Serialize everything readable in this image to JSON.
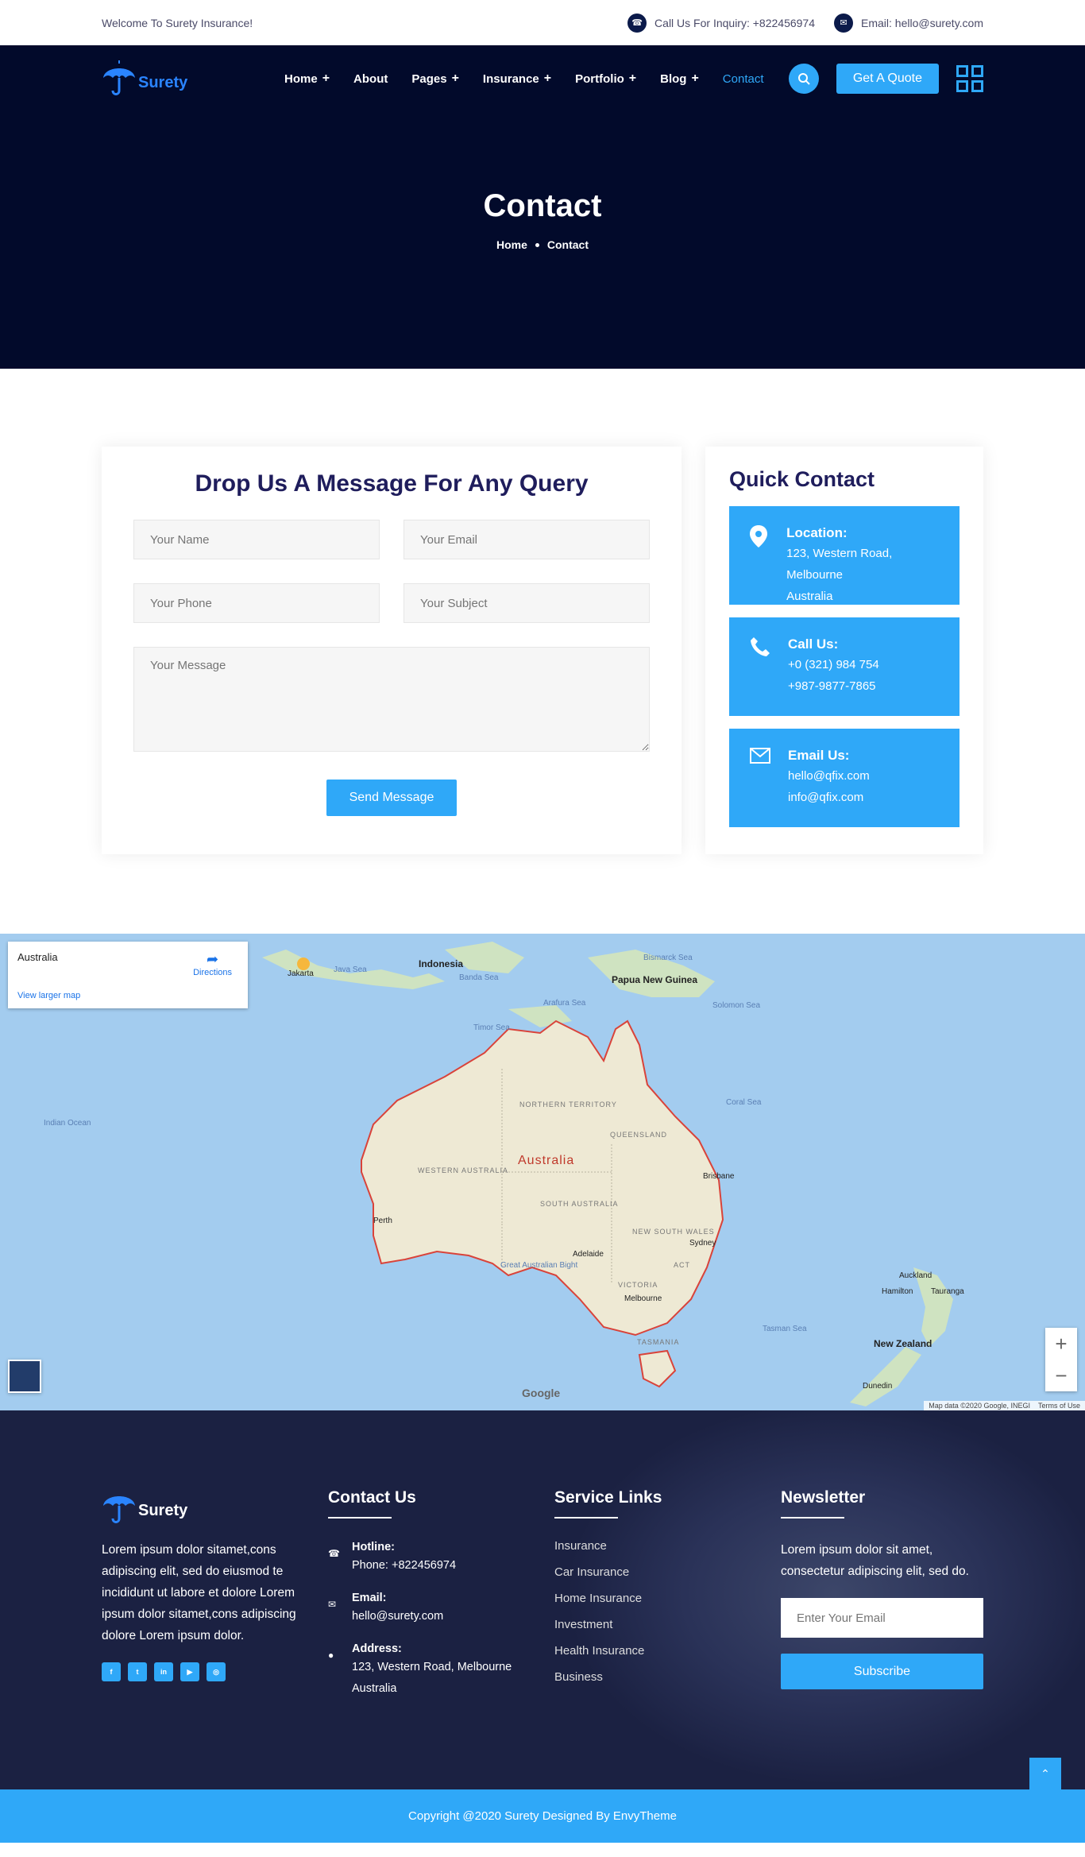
{
  "topbar": {
    "welcome": "Welcome To Surety Insurance!",
    "phone_text": "Call Us For Inquiry: +822456974",
    "email_text": "Email: hello@surety.com"
  },
  "brand": {
    "name": "Surety",
    "logo_icon": "umbrella-icon"
  },
  "nav": {
    "items": [
      {
        "label": "Home",
        "has_sub": true
      },
      {
        "label": "About",
        "has_sub": false
      },
      {
        "label": "Pages",
        "has_sub": true
      },
      {
        "label": "Insurance",
        "has_sub": true
      },
      {
        "label": "Portfolio",
        "has_sub": true
      },
      {
        "label": "Blog",
        "has_sub": true
      },
      {
        "label": "Contact",
        "has_sub": false,
        "active": true
      }
    ],
    "quote_label": "Get A Quote"
  },
  "hero": {
    "title": "Contact",
    "breadcrumb": [
      "Home",
      "Contact"
    ]
  },
  "form": {
    "title": "Drop Us A Message For Any Query",
    "name_placeholder": "Your Name",
    "email_placeholder": "Your Email",
    "phone_placeholder": "Your Phone",
    "subject_placeholder": "Your Subject",
    "message_placeholder": "Your Message",
    "send_label": "Send Message"
  },
  "quick_contact": {
    "title": "Quick Contact",
    "boxes": [
      {
        "icon": "location-pin-icon",
        "title": "Location:",
        "lines": [
          "123, Western Road, Melbourne",
          "Australia"
        ]
      },
      {
        "icon": "phone-icon",
        "title": "Call Us:",
        "lines": [
          "+0 (321) 984 754",
          "+987-9877-7865"
        ]
      },
      {
        "icon": "envelope-icon",
        "title": "Email Us:",
        "lines": [
          "hello@qfix.com",
          "info@qfix.com"
        ]
      }
    ]
  },
  "map": {
    "place": "Australia",
    "directions": "Directions",
    "view_larger": "View larger map",
    "country_label": "Australia",
    "labels": {
      "indonesia": "Indonesia",
      "java_sea": "Java Sea",
      "banda_sea": "Banda Sea",
      "png": "Papua New Guinea",
      "bismarck": "Bismarck Sea",
      "solomon": "Solomon Sea",
      "arafura": "Arafura Sea",
      "timor": "Timor Sea",
      "coral": "Coral Sea",
      "indian": "Indian Ocean",
      "tasman": "Tasman Sea",
      "nt": "NORTHERN TERRITORY",
      "qld": "QUEENSLAND",
      "wa": "WESTERN AUSTRALIA",
      "sa": "SOUTH AUSTRALIA",
      "nsw": "NEW SOUTH WALES",
      "vic": "VICTORIA",
      "act": "ACT",
      "tas": "TASMANIA",
      "gab": "Great Australian Bight",
      "jakarta": "Jakarta",
      "perth": "Perth",
      "adelaide": "Adelaide",
      "melbourne": "Melbourne",
      "sydney": "Sydney",
      "brisbane": "Brisbane",
      "auckland": "Auckland",
      "hamilton": "Hamilton",
      "tauranga": "Tauranga",
      "nz": "New Zealand",
      "dunedin": "Dunedin"
    },
    "attribution": "Map data ©2020 Google, INEGI",
    "terms": "Terms of Use",
    "google": "Google"
  },
  "footer": {
    "about": "Lorem ipsum dolor sitamet,cons adipiscing elit, sed do eiusmod te incididunt ut labore et dolore Lorem ipsum dolor sitamet,cons adipiscing dolore Lorem ipsum dolor.",
    "socials": [
      "facebook-icon",
      "twitter-icon",
      "linkedin-icon",
      "youtube-icon",
      "instagram-icon"
    ],
    "contact_title": "Contact Us",
    "contacts": [
      {
        "icon": "phone-icon",
        "title": "Hotline:",
        "lines": [
          "Phone: +822456974"
        ]
      },
      {
        "icon": "envelope-icon",
        "title": "Email:",
        "lines": [
          "hello@surety.com"
        ]
      },
      {
        "icon": "location-pin-icon",
        "title": "Address:",
        "lines": [
          "123, Western Road, Melbourne",
          "Australia"
        ]
      }
    ],
    "links_title": "Service Links",
    "links": [
      "Insurance",
      "Car Insurance",
      "Home Insurance",
      "Investment",
      "Health Insurance",
      "Business"
    ],
    "news_title": "Newsletter",
    "news_text": "Lorem ipsum dolor sit amet, consectetur adipiscing elit, sed do.",
    "email_placeholder": "Enter Your Email",
    "subscribe_label": "Subscribe"
  },
  "copyright": "Copyright @2020 Surety Designed By EnvyTheme",
  "colors": {
    "navy": "#020a2b",
    "accent": "#2fa8f8",
    "heading": "#1f1d5c"
  }
}
